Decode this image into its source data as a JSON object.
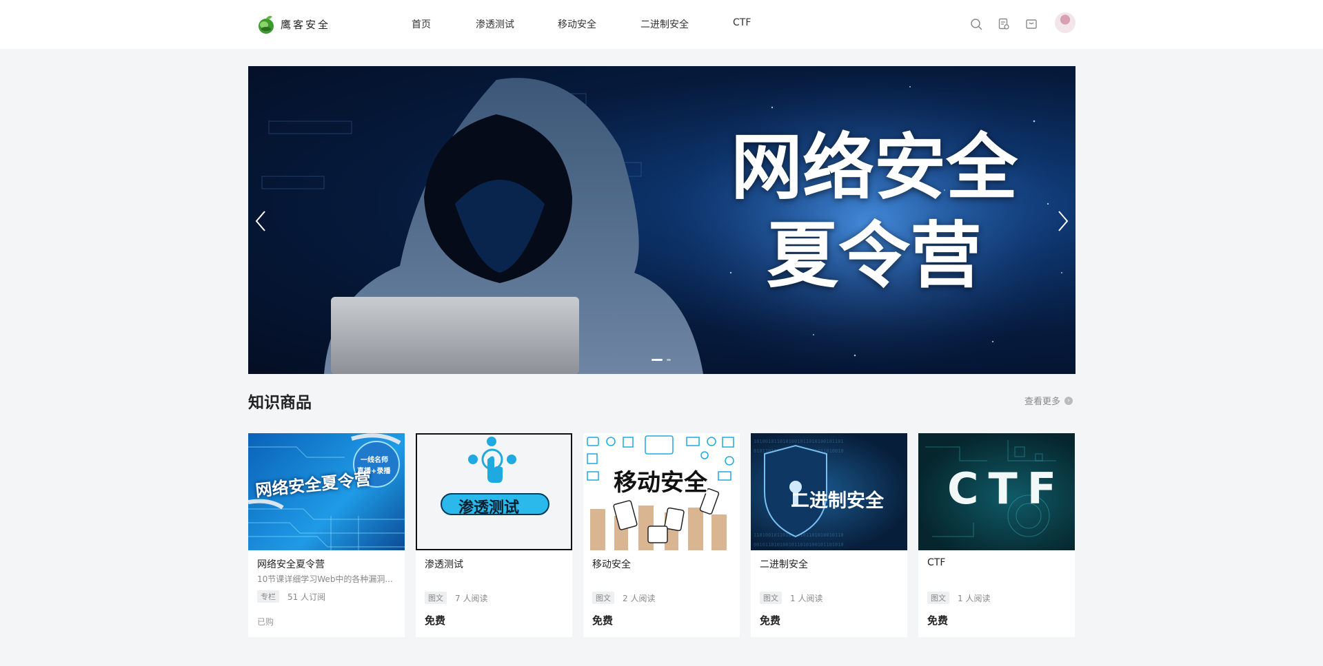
{
  "header": {
    "logo_text": "鹰客安全",
    "nav": [
      "首页",
      "渗透测试",
      "移动安全",
      "二进制安全",
      "CTF"
    ]
  },
  "banner": {
    "line1": "网络安全",
    "line2": "夏令营",
    "slide_count": 2,
    "active_slide": 0
  },
  "section": {
    "title": "知识商品",
    "more_label": "查看更多"
  },
  "cards": [
    {
      "title": "网络安全夏令营",
      "desc": "10节课详细学习Web中的各种漏洞...",
      "tag": "专栏",
      "stat": "51 人订阅",
      "status": "已购",
      "thumb_text": "网络安全夏令营",
      "thumb_badge": [
        "一线名师",
        "直播+录播"
      ]
    },
    {
      "title": "渗透测试",
      "tag": "图文",
      "stat": "7 人阅读",
      "price": "免费",
      "thumb_text": "渗透测试"
    },
    {
      "title": "移动安全",
      "tag": "图文",
      "stat": "2 人阅读",
      "price": "免费",
      "thumb_text": "移动安全"
    },
    {
      "title": "二进制安全",
      "tag": "图文",
      "stat": "1 人阅读",
      "price": "免费",
      "thumb_text": "二进制安全"
    },
    {
      "title": "CTF",
      "tag": "图文",
      "stat": "1 人阅读",
      "price": "免费",
      "thumb_text": "CTF"
    }
  ]
}
